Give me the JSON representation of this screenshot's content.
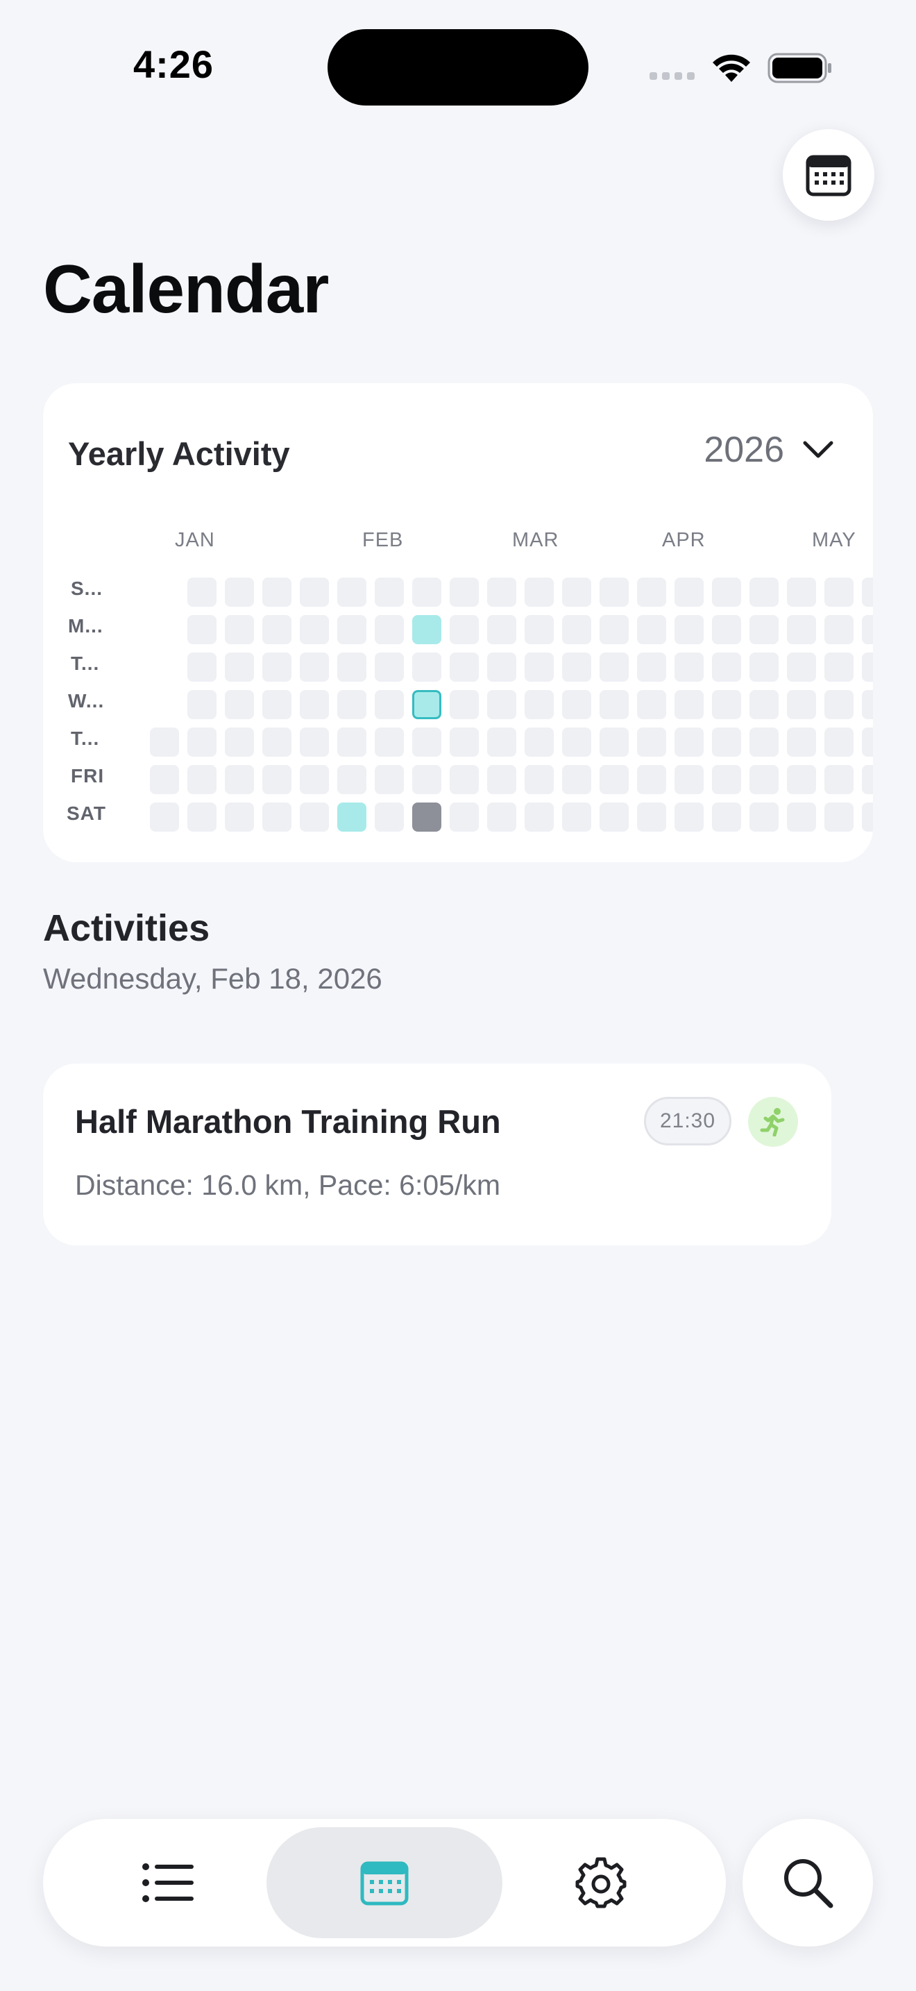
{
  "status_bar": {
    "time": "4:26"
  },
  "page": {
    "title": "Calendar"
  },
  "yearly_activity": {
    "title": "Yearly Activity",
    "year": "2026",
    "months": [
      "JAN",
      "FEB",
      "MAR",
      "APR",
      "MAY"
    ],
    "day_labels": [
      "S...",
      "M...",
      "T...",
      "W...",
      "T...",
      "FRI",
      "SAT"
    ]
  },
  "activities": {
    "heading": "Activities",
    "date": "Wednesday, Feb 18, 2026",
    "items": [
      {
        "title": "Half Marathon Training Run",
        "detail": "Distance: 16.0 km, Pace: 6:05/km",
        "time": "21:30",
        "type_icon": "running-icon",
        "type_color": "#8fd16a"
      }
    ]
  },
  "colors": {
    "accent": "#2fb9c0",
    "active_cell": "#a8eaea",
    "today_cell": "#8d9099"
  },
  "tab_bar": {
    "tabs": [
      {
        "name": "list-icon",
        "selected": false
      },
      {
        "name": "calendar-icon",
        "selected": true
      },
      {
        "name": "gear-icon",
        "selected": false
      }
    ],
    "search": "search-icon"
  }
}
